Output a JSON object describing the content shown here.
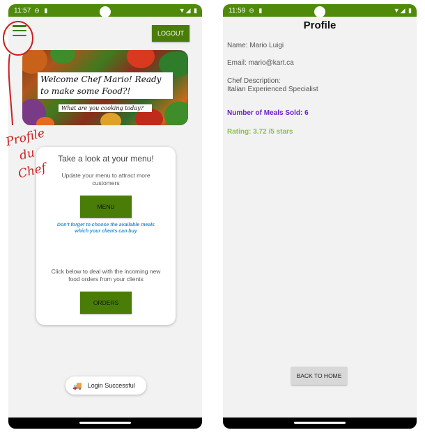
{
  "left_screen": {
    "status": {
      "time": "11:57",
      "icons": "⊖ ▮",
      "right_icons": "▼◢ ▮"
    },
    "menu_icon": "hamburger-icon",
    "logout_label": "LOGOUT",
    "banner": {
      "title": "Welcome Chef Mario! Ready to make some Food?!",
      "subtitle": "What are you cooking today?"
    },
    "annotation": [
      "Profile",
      "du",
      "Chef"
    ],
    "card": {
      "title": "Take a look at your menu!",
      "menu_desc": "Update your menu to attract more customers",
      "menu_button": "MENU",
      "hint": "Don't forget to choose the available meals which your clients can buy",
      "orders_desc": "Click below to deal with the incoming new food orders from your clients",
      "orders_button": "ORDERS"
    },
    "toast": {
      "icon": "truck-icon",
      "text": "Login Successful"
    }
  },
  "right_screen": {
    "status": {
      "time": "11:59",
      "icons": "⊖ ▮",
      "right_icons": "▼◢ ▮"
    },
    "title": "Profile",
    "name": "Name: Mario Luigi",
    "email": "Email: mario@kart.ca",
    "desc_label": "Chef Description:",
    "desc_value": "Italian Experienced Specialist",
    "meals": "Number of Meals Sold: 6",
    "rating": "Rating: 3.72 /5 stars",
    "back_button": "BACK TO HOME"
  },
  "colors": {
    "primary": "#4f8a0b",
    "button": "#4a7d08",
    "annotation": "#cc1f1f",
    "meals": "#6b1fd3",
    "rating": "#8cc04a",
    "hint": "#2b8ed6"
  }
}
